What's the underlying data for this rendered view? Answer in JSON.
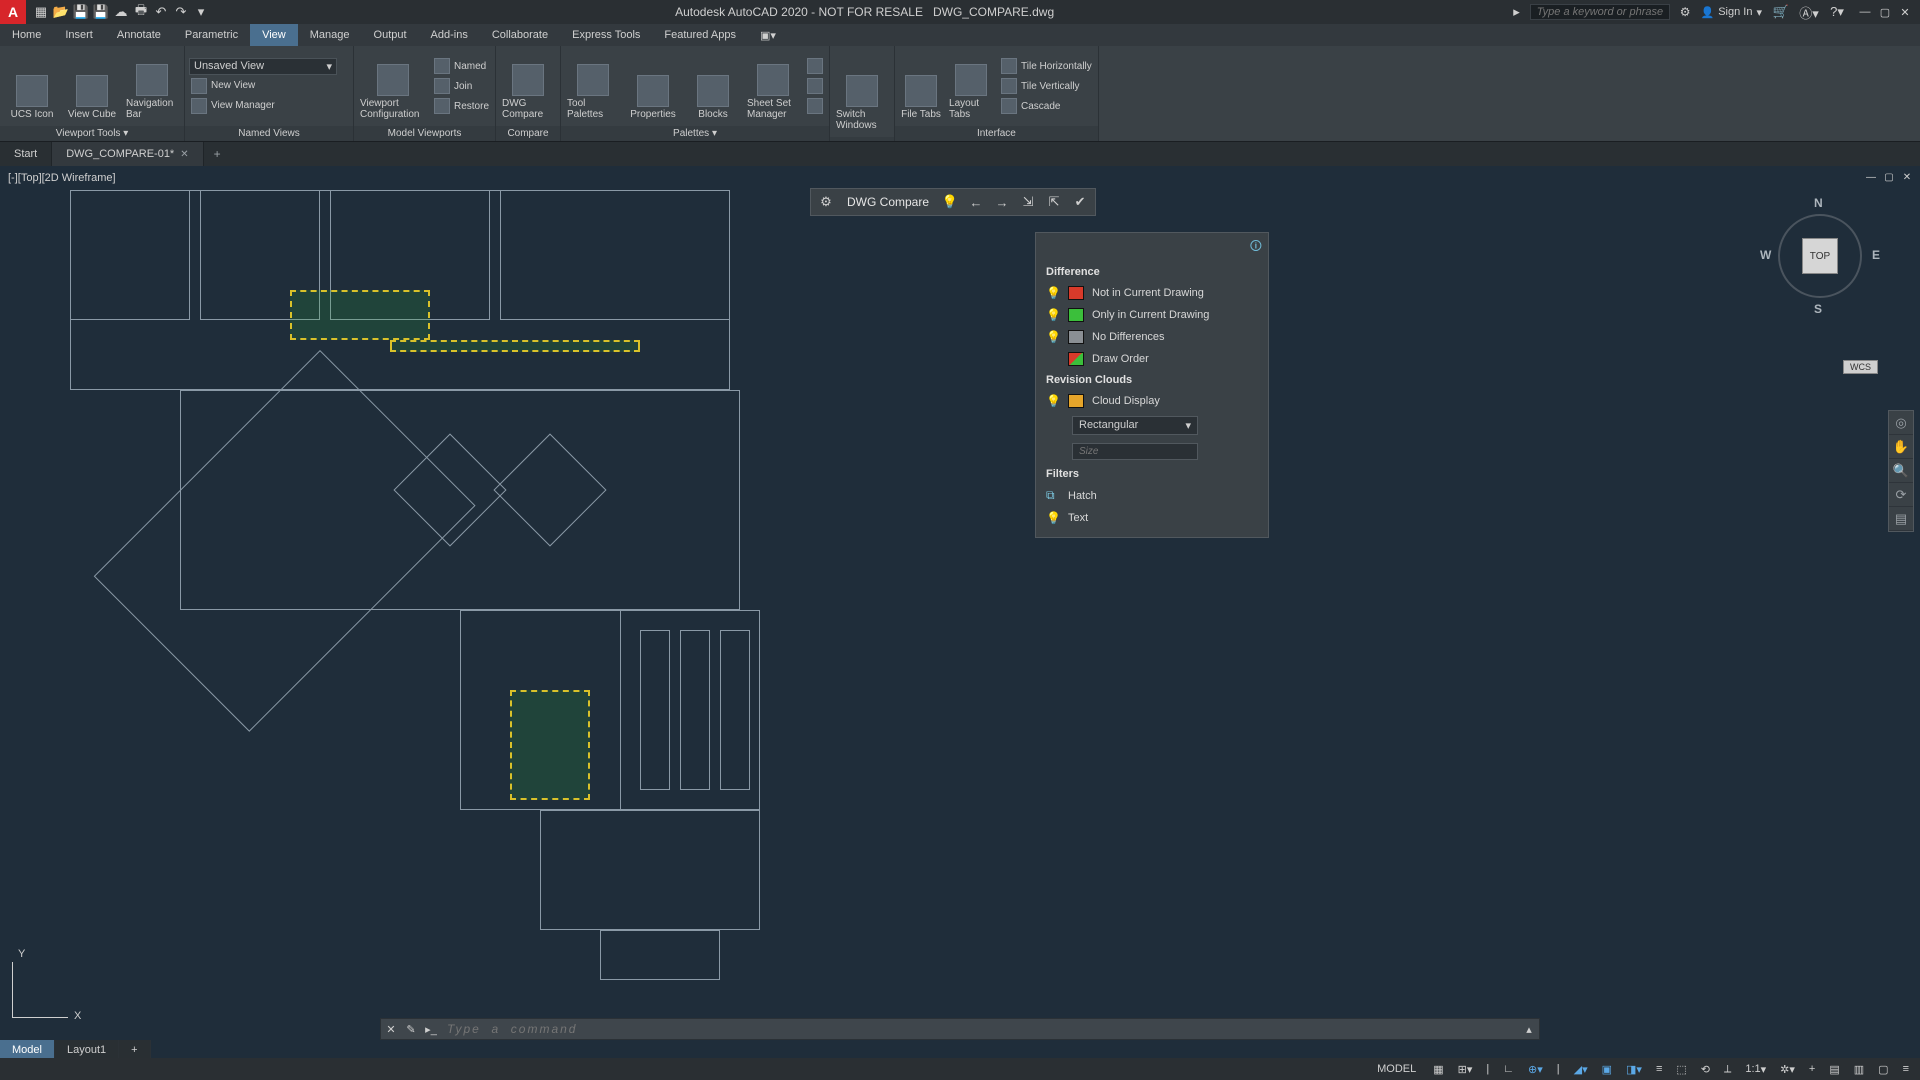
{
  "title": {
    "app": "Autodesk AutoCAD 2020 - NOT FOR RESALE",
    "file": "DWG_COMPARE.dwg"
  },
  "search": {
    "placeholder": "Type a keyword or phrase"
  },
  "signin": {
    "label": "Sign In"
  },
  "menu": {
    "tabs": [
      "Home",
      "Insert",
      "Annotate",
      "Parametric",
      "View",
      "Manage",
      "Output",
      "Add-ins",
      "Collaborate",
      "Express Tools",
      "Featured Apps"
    ],
    "active": "View"
  },
  "ribbon": {
    "viewport_tools": {
      "ucs_icon": "UCS Icon",
      "view_cube": "View Cube",
      "nav_bar": "Navigation Bar",
      "title": "Viewport Tools ▾"
    },
    "named_views": {
      "combo": "Unsaved View",
      "new_view": "New View",
      "view_manager": "View Manager",
      "title": "Named Views"
    },
    "model_viewports": {
      "viewport_config": "Viewport Configuration",
      "named": "Named",
      "join": "Join",
      "restore": "Restore",
      "title": "Model Viewports"
    },
    "compare": {
      "dwg_compare": "DWG Compare",
      "title": "Compare"
    },
    "palettes": {
      "tool_palettes": "Tool Palettes",
      "properties": "Properties",
      "blocks": "Blocks",
      "sheetset": "Sheet Set Manager",
      "title": "Palettes ▾"
    },
    "switch_windows": "Switch Windows",
    "interface": {
      "file_tabs": "File Tabs",
      "layout_tabs": "Layout Tabs",
      "tile_h": "Tile Horizontally",
      "tile_v": "Tile Vertically",
      "cascade": "Cascade",
      "title": "Interface"
    }
  },
  "file_tabs": {
    "start": "Start",
    "current": "DWG_COMPARE-01*"
  },
  "viewport": {
    "label": "[-][Top][2D Wireframe]"
  },
  "compare_toolbar": {
    "label": "DWG Compare"
  },
  "compare_panel": {
    "difference": "Difference",
    "not_in_current": "Not in Current Drawing",
    "only_in_current": "Only in Current Drawing",
    "no_diff": "No Differences",
    "draw_order": "Draw Order",
    "revision_clouds": "Revision Clouds",
    "cloud_display": "Cloud Display",
    "shape": "Rectangular",
    "size_placeholder": "Size",
    "filters": "Filters",
    "hatch": "Hatch",
    "text": "Text"
  },
  "viewcube": {
    "top": "TOP",
    "n": "N",
    "s": "S",
    "e": "E",
    "w": "W",
    "wcs": "WCS"
  },
  "ucs": {
    "x": "X",
    "y": "Y"
  },
  "cmdline": {
    "placeholder": "Type  a  command"
  },
  "layout_tabs": {
    "model": "Model",
    "layout1": "Layout1"
  },
  "status": {
    "model": "MODEL",
    "scale": "1:1"
  }
}
